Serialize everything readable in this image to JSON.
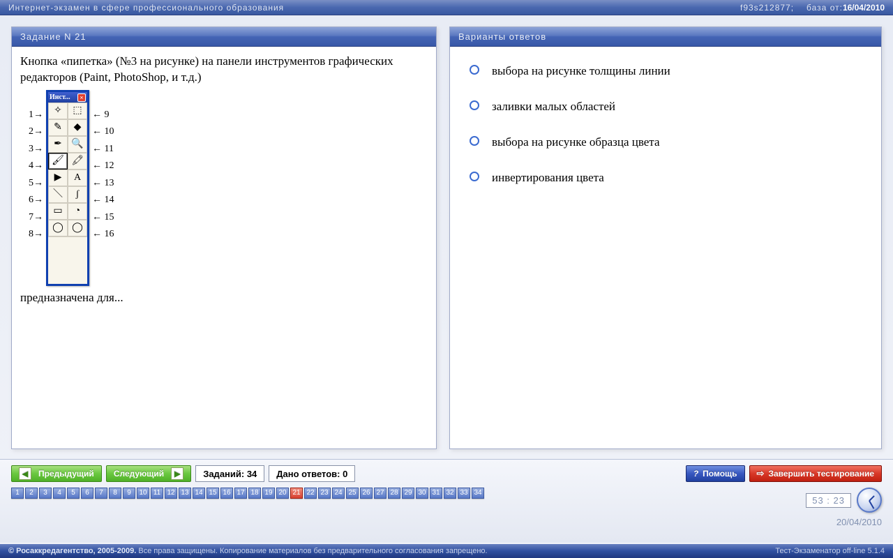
{
  "topbar": {
    "title": "Интернет-экзамен в сфере профессионального образования",
    "session": "f93s212877;",
    "db_label": "база от:",
    "db_date": "16/04/2010"
  },
  "question_panel": {
    "header": "Задание N 21",
    "text_before": "Кнопка «пипетка» (№3 на рисунке) на панели инструментов графических редакторов (Paint, PhotoShop, и т.д.)",
    "text_after": "предназначена для...",
    "toolbox_title": "Инст...",
    "left_labels": [
      "1→",
      "2→",
      "3→",
      "4→",
      "5→",
      "6→",
      "7→",
      "8→"
    ],
    "right_labels": [
      "← 9",
      "← 10",
      "← 11",
      "← 12",
      "← 13",
      "← 14",
      "← 15",
      "← 16"
    ],
    "tools": [
      "✧",
      "⬚",
      "✎",
      "◆",
      "✒",
      "🔍",
      "🖌",
      "🖍",
      "▶",
      "A",
      "＼",
      "ʃ",
      "▭",
      "◔",
      "◯",
      "◯"
    ]
  },
  "answers_panel": {
    "header": "Варианты ответов",
    "options": [
      "выбора на рисунке толщины линии",
      "заливки малых областей",
      "выбора на рисунке образца цвета",
      "инвертирования цвета"
    ]
  },
  "controls": {
    "prev": "Предыдущий",
    "next": "Следующий",
    "tasks": "Заданий: 34",
    "answered": "Дано ответов: 0",
    "help": "Помощь",
    "finish": "Завершить тестирование"
  },
  "nav": {
    "total": 34,
    "current": 21
  },
  "clock": {
    "time": "53 : 23",
    "date": "20/04/2010"
  },
  "footer": {
    "copyright": "© Росаккредагентство, 2005-2009.",
    "rights": "Все права защищены. Копирование материалов без предварительного согласования запрещено.",
    "version": "Тест-Экзаменатор off-line 5.1.4"
  }
}
